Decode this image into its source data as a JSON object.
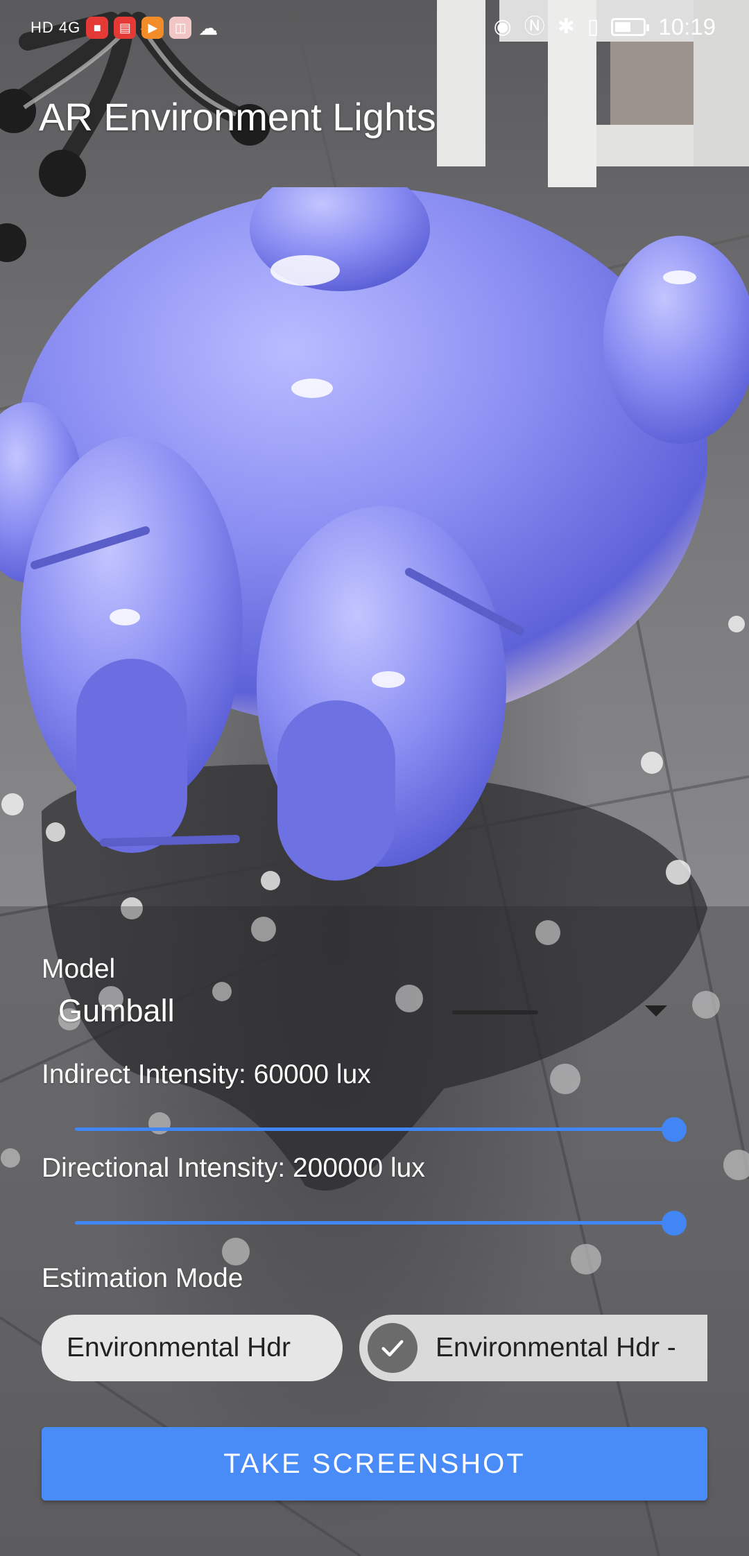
{
  "status_bar": {
    "network": "HD 4G",
    "time": "10:19",
    "notification_icons": [
      "video-icon",
      "huawei-video-icon",
      "play-icon",
      "gift-icon",
      "wechat-icon"
    ],
    "system_icons": [
      "eye-comfort-icon",
      "nfc-icon",
      "bluetooth-icon",
      "vibrate-icon",
      "battery-icon"
    ]
  },
  "app": {
    "title": "AR Environment Lights"
  },
  "controls": {
    "model_label": "Model",
    "model_value": "Gumball",
    "indirect_label": "Indirect Intensity: 60000 lux",
    "indirect_fraction": 1.0,
    "directional_label": "Directional Intensity: 200000 lux",
    "directional_fraction": 1.0,
    "estimation_label": "Estimation Mode",
    "modes": [
      {
        "label": "Environmental Hdr",
        "selected": false
      },
      {
        "label": "Environmental Hdr -",
        "selected": true
      }
    ],
    "screenshot_button": "TAKE SCREENSHOT"
  },
  "colors": {
    "accent": "#4285f4",
    "button": "#4a8cf7",
    "model": "#8c8ef0"
  }
}
